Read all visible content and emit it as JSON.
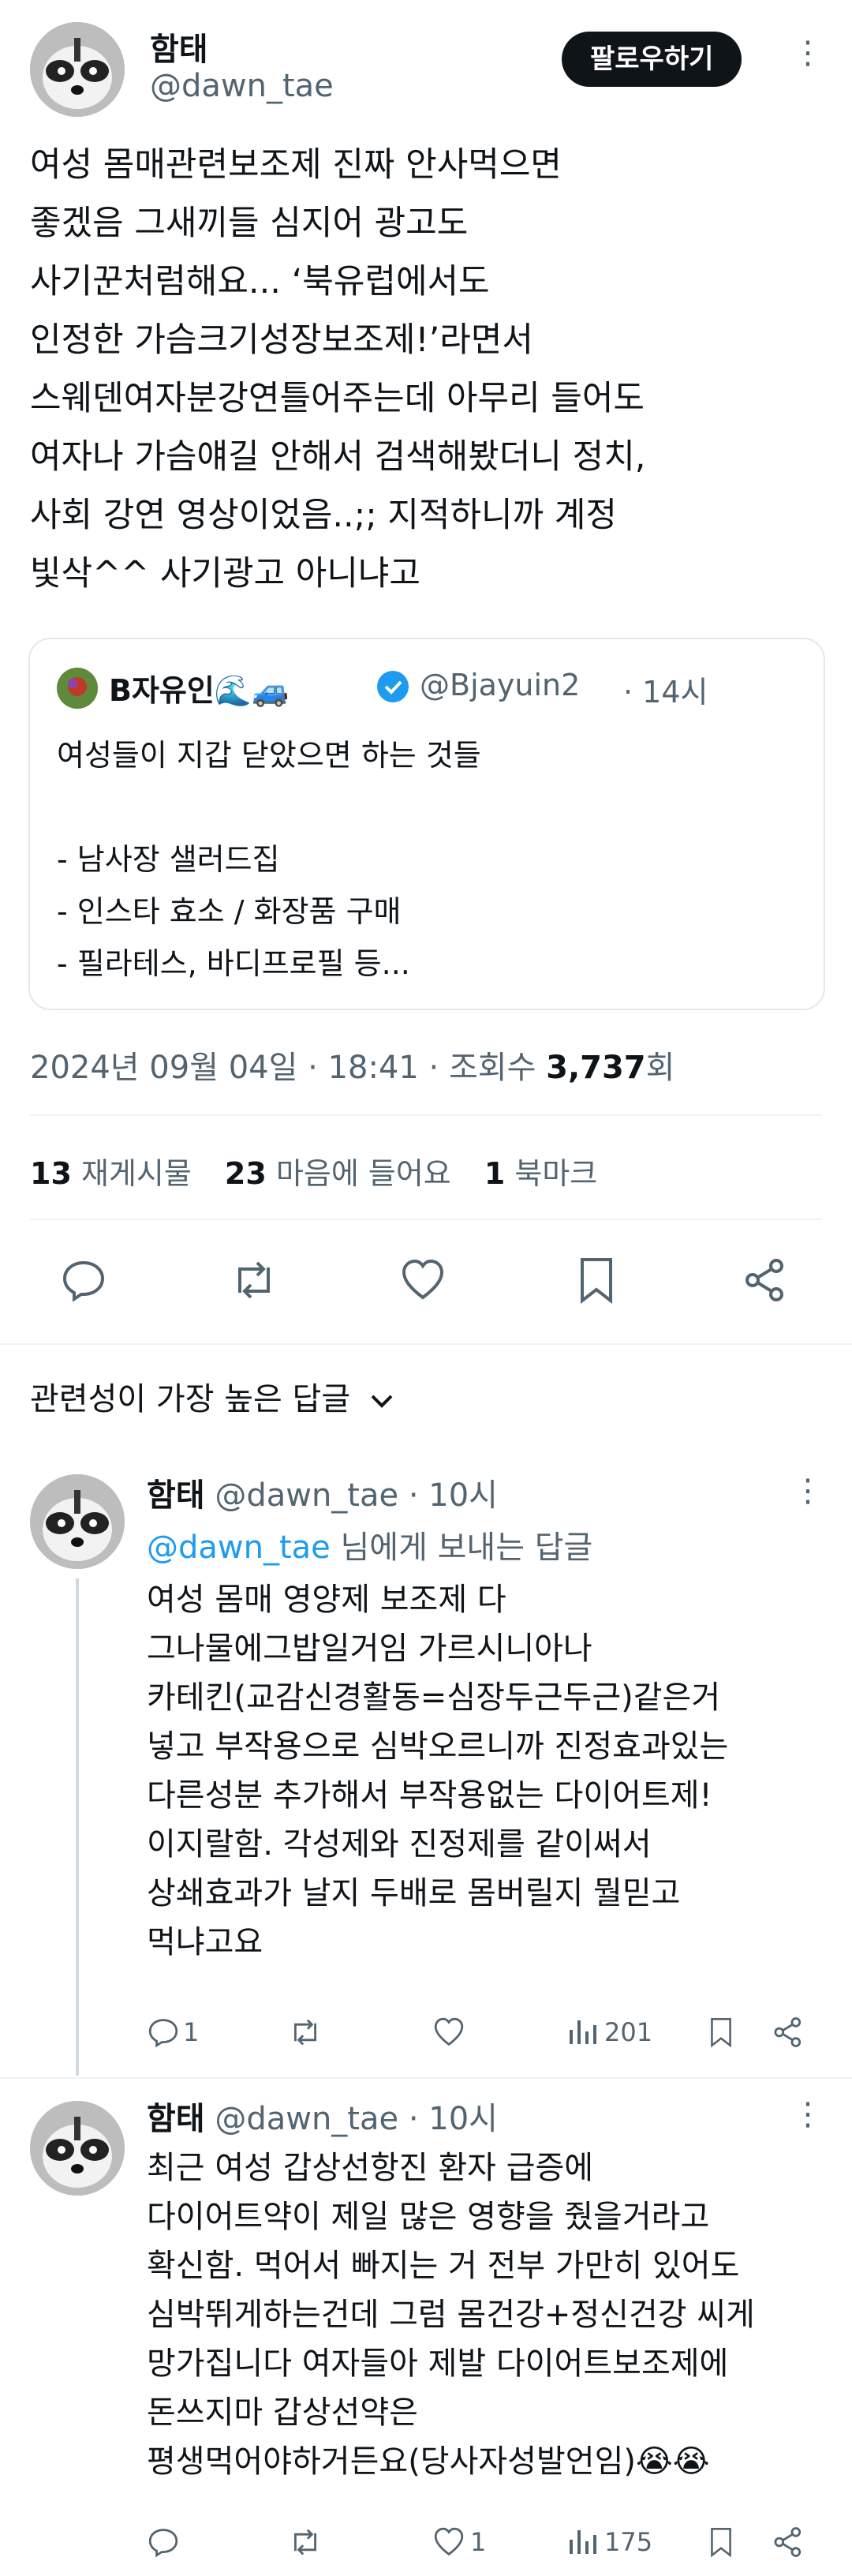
{
  "main_post": {
    "author_name": "함태",
    "author_handle": "@dawn_tae",
    "follow_label": "팔로우하기",
    "more": "⋮",
    "text_lines": [
      "여성 몸매관련보조제 진짜 안사먹으면",
      "좋겠음 그새끼들 심지어 광고도",
      "사기꾼처럼해요... ‘북유럽에서도",
      "인정한 가슴크기성장보조제!’라면서",
      "스웨덴여자분강연틀어주는데 아무리 들어도",
      "여자나 가슴얘길 안해서 검색해봤더니 정치,",
      "사회 강연 영상이었음..;; 지적하니까 계정",
      "빛삭^^ 사기광고 아니냐고"
    ],
    "quote": {
      "name": "B자유인🌊🚙",
      "handle": "@Bjayuin2",
      "time": "· 14시",
      "lines": [
        "여성들이 지갑 닫았으면 하는 것들",
        "",
        "- 남사장 샐러드집",
        "- 인스타 효소 / 화장품 구매",
        "- 필라테스, 바디프로필 등..."
      ]
    },
    "timestamp": "2024년 09월 04일 · 18:41 · 조회수 ",
    "views": "3,737",
    "views_suffix": "회",
    "stats": {
      "reposts_count": "13",
      "reposts_label": "재게시물",
      "likes_count": "23",
      "likes_label": "마음에 들어요",
      "bookmarks_count": "1",
      "bookmarks_label": "북마크"
    }
  },
  "sort_label": "관련성이 가장 높은 답글",
  "replies": [
    {
      "author_name": "함태",
      "author_handle": "@dawn_tae · 10시",
      "reply_to_handle": "@dawn_tae",
      "reply_to_suffix": " 님에게 보내는 답글",
      "lines": [
        "여성 몸매 영양제 보조제 다",
        "그나물에그밥일거임 가르시니아나",
        "카테킨(교감신경활동=심장두근두근)같은거",
        "넣고 부작용으로 심박오르니까 진정효과있는",
        "다른성분 추가해서 부작용없는 다이어트제!",
        "이지랄함. 각성제와 진정제를 같이써서",
        "상쇄효과가 날지 두배로 몸버릴지 뭘믿고",
        "먹냐고요"
      ],
      "reply_count": "1",
      "retweet_count": "",
      "like_count": "",
      "views_count": "201"
    },
    {
      "author_name": "함태",
      "author_handle": "@dawn_tae · 10시",
      "lines": [
        "최근 여성 갑상선항진 환자 급증에",
        "다이어트약이 제일 많은 영향을 줬을거라고",
        "확신함. 먹어서 빠지는 거 전부 가만히 있어도",
        "심박뛰게하는건데 그럼 몸건강+정신건강 씨게",
        "망가집니다 여자들아 제발 다이어트보조제에",
        "돈쓰지마 갑상선약은",
        "평생먹어야하거든요(당사자성발언임)😭😭"
      ],
      "reply_count": "",
      "retweet_count": "",
      "like_count": "1",
      "views_count": "175"
    }
  ]
}
